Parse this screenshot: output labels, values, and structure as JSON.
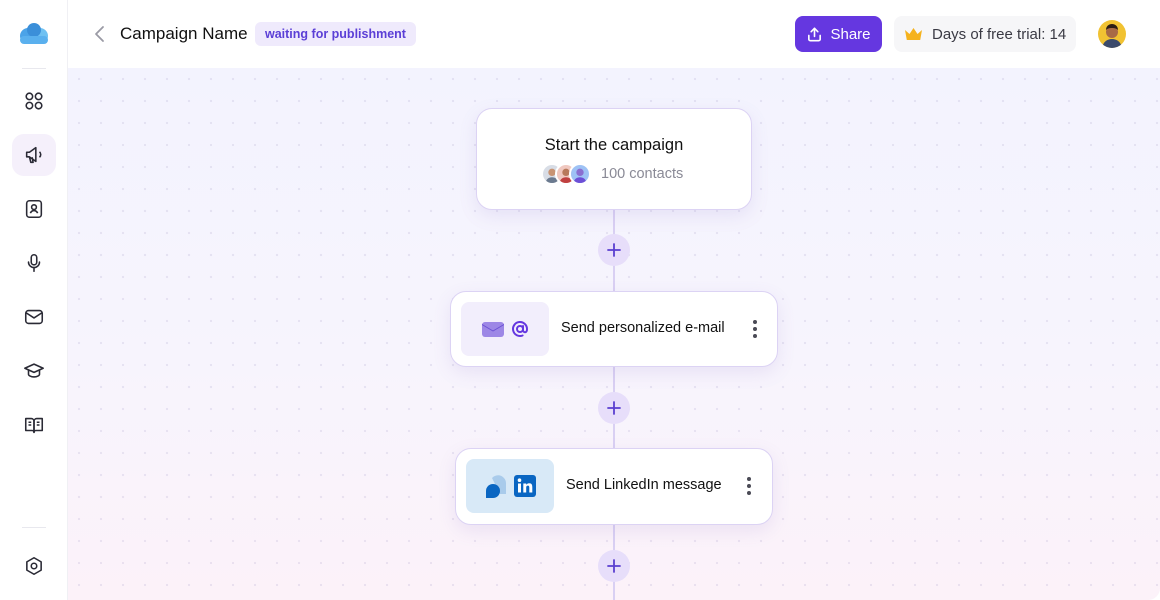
{
  "header": {
    "title": "Campaign Name",
    "status": "waiting for publishment",
    "share_label": "Share",
    "trial_label": "Days of free trial: 14"
  },
  "sidebar": {
    "items": [
      {
        "icon": "grid-icon",
        "active": false
      },
      {
        "icon": "megaphone-icon",
        "active": true
      },
      {
        "icon": "contacts-book-icon",
        "active": false
      },
      {
        "icon": "microphone-icon",
        "active": false
      },
      {
        "icon": "mail-icon",
        "active": false
      },
      {
        "icon": "graduation-cap-icon",
        "active": false
      },
      {
        "icon": "book-open-icon",
        "active": false
      }
    ],
    "settings_icon": "settings-icon"
  },
  "canvas": {
    "start": {
      "title": "Start the campaign",
      "contacts": "100 contacts"
    },
    "steps": [
      {
        "label": "Send personalized e-mail",
        "icon": "email-at-icon"
      },
      {
        "label": "Send LinkedIn message",
        "icon": "linkedin-icon"
      }
    ]
  },
  "colors": {
    "accent": "#6537e0",
    "badge_bg": "#efeafc",
    "badge_text": "#5b3fd6",
    "linkedin": "#0a66c2"
  }
}
